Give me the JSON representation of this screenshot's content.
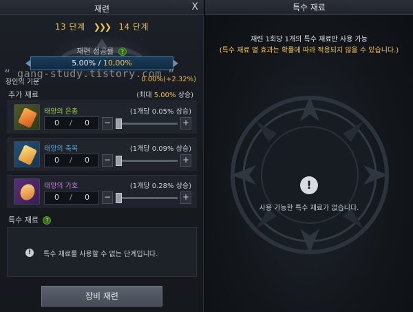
{
  "left_panel": {
    "title": "재련",
    "close_label": "X",
    "stage_from": "13 단계",
    "stage_arrows": "❯❯❯",
    "stage_to": "14 단계",
    "success_rate_label": "재련 성공률",
    "success_rate_base": "5.00% / ",
    "success_rate_total": "10,00%",
    "watermark": "“ gang-study.tistory.com ”",
    "artisan_label": "장인의 기운",
    "artisan_value": "0.00%(+2.32%)",
    "additional_materials_label": "추가 재료",
    "max_increase_prefix": "(최대 ",
    "max_increase_value": "5.00%",
    "max_increase_suffix": " 상승)",
    "materials": [
      {
        "name": "태양의 은총",
        "rate": "(1개당 0.05% 상승)",
        "qty": "0",
        "max": "0",
        "name_color": "#9ccc3d",
        "icon": "orange-crystal-icon"
      },
      {
        "name": "태양의 축복",
        "rate": "(1개당 0.09% 상승)",
        "qty": "0",
        "max": "0",
        "name_color": "#4fa6e0",
        "icon": "blue-gold-crystal-icon"
      },
      {
        "name": "태양의 가호",
        "rate": "(1개당 0.28% 상승)",
        "qty": "0",
        "max": "0",
        "name_color": "#c47be0",
        "icon": "purple-crystal-icon"
      }
    ],
    "qty_separator": "/",
    "special_label": "특수 재료",
    "special_unavailable_message": "특수 재료를 사용할 수 없는 단계입니다.",
    "hone_button_label": "장비 재련",
    "help_glyph": "?",
    "alert_glyph": "!"
  },
  "right_panel": {
    "title": "특수 재료",
    "info_line1": "재련 1회당 1개의 특수 재료만 사용 가능",
    "info_line2": "(특수 재료 별 효과는 확률에 따라 적용되지 않을 수 있습니다.)",
    "empty_message": "사용 가능한 특수 재료가 없습니다.",
    "alert_glyph": "!"
  },
  "colors": {
    "accent_gold": "#f2c24f",
    "stage_gold": "#e7b84a",
    "rate_bar_blue": "#1b3c5a"
  }
}
